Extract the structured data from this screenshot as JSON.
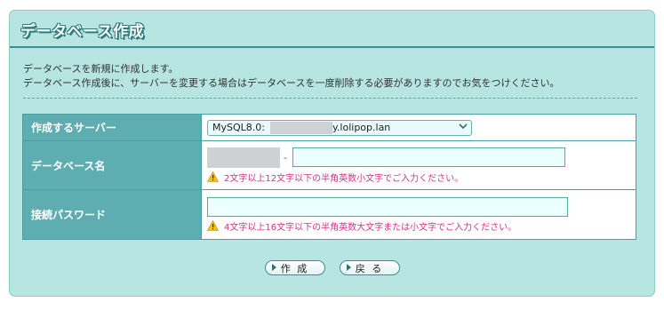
{
  "page": {
    "title": "データベース作成",
    "description": [
      "データベースを新規に作成します。",
      "データベース作成後に、サーバーを変更する場合はデータベースを一度削除する必要がありますのでお気をつけください。"
    ]
  },
  "form": {
    "server": {
      "label": "作成するサーバー",
      "selected_prefix": "MySQL8.0:",
      "selected_suffix": "y.lolipop.lan"
    },
    "dbname": {
      "label": "データベース名",
      "separator": "-",
      "value": "",
      "hint": "2文字以上12文字以下の半角英数小文字でご入力ください。"
    },
    "password": {
      "label": "接続パスワード",
      "value": "",
      "hint": "4文字以上16文字以下の半角英数大文字または小文字でご入力ください。"
    }
  },
  "buttons": {
    "create": "作 成",
    "back": "戻 る"
  },
  "colors": {
    "panel_bg": "#b7e6e2",
    "header_cell": "#5eaeb1",
    "hint_text": "#d63384",
    "warning_icon": "#f3c21b"
  }
}
